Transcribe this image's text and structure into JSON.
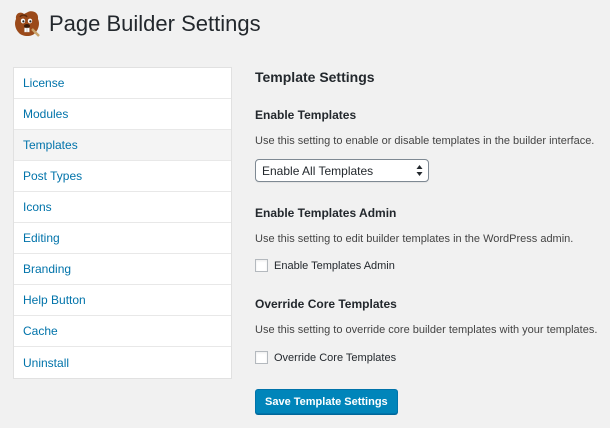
{
  "header": {
    "logo_icon": "beaver-logo-icon",
    "title": "Page Builder Settings"
  },
  "sidebar": {
    "items": [
      {
        "label": "License"
      },
      {
        "label": "Modules"
      },
      {
        "label": "Templates"
      },
      {
        "label": "Post Types"
      },
      {
        "label": "Icons"
      },
      {
        "label": "Editing"
      },
      {
        "label": "Branding"
      },
      {
        "label": "Help Button"
      },
      {
        "label": "Cache"
      },
      {
        "label": "Uninstall"
      }
    ],
    "active_item": "Templates"
  },
  "main": {
    "section_title": "Template Settings",
    "enable_templates": {
      "title": "Enable Templates",
      "description": "Use this setting to enable or disable templates in the builder interface.",
      "selected": "Enable All Templates"
    },
    "templates_admin": {
      "title": "Enable Templates Admin",
      "description": "Use this setting to edit builder templates in the WordPress admin.",
      "checkbox_label": "Enable Templates Admin",
      "checked": false
    },
    "override_core": {
      "title": "Override Core Templates",
      "description": "Use this setting to override core builder templates with your templates.",
      "checkbox_label": "Override Core Templates",
      "checked": false
    },
    "save_label": "Save Template Settings"
  },
  "colors": {
    "background": "#f1f1f1",
    "link": "#0073aa",
    "primary_button": "#0085ba"
  }
}
